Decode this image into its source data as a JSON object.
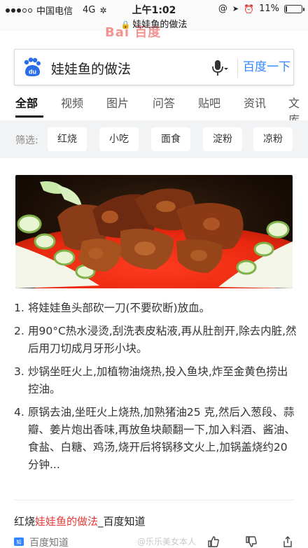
{
  "status_bar": {
    "carrier": "中国电信",
    "network": "4G",
    "time": "上午1:02",
    "battery_text": "11%",
    "battery_level": 0.11
  },
  "url_bar": {
    "page_title": "娃娃鱼的做法",
    "ghost_logo": "Bai 百度"
  },
  "search": {
    "query": "娃娃鱼的做法",
    "button_label": "百度一下",
    "logo_label": "du"
  },
  "tabs": [
    {
      "label": "全部",
      "active": true
    },
    {
      "label": "视频",
      "active": false
    },
    {
      "label": "图片",
      "active": false
    },
    {
      "label": "问答",
      "active": false
    },
    {
      "label": "贴吧",
      "active": false
    },
    {
      "label": "资讯",
      "active": false
    },
    {
      "label": "文库",
      "active": false
    }
  ],
  "filter": {
    "label": "筛选:",
    "chips": [
      "红烧",
      "小吃",
      "面食",
      "淀粉",
      "凉粉"
    ]
  },
  "result": {
    "steps": [
      {
        "num": "1.",
        "text": "将娃娃鱼头部砍一刀(不要砍断)放血。"
      },
      {
        "num": "2.",
        "text": "用90°C热水浸烫,刮洗表皮粘液,再从肚剖开,除去内脏,然后用刀切成月牙形小块。"
      },
      {
        "num": "3.",
        "text": "炒锅坐旺火上,加植物油烧热,投入鱼块,炸至金黄色捞出控油。"
      },
      {
        "num": "4.",
        "text": "原锅去油,坐旺火上烧热,加熟猪油25 克,然后入葱段、蒜瓣、姜片炮出香味,再放鱼块颠翻一下,加入料酒、酱油、食盐、白糖、鸡汤,烧开后将锅移文火上,加锅盖烧约20 分钟..."
      }
    ],
    "title_prefix": "红烧",
    "title_highlight": "娃娃鱼的做法",
    "title_suffix": "_百度知道",
    "source": "百度知道",
    "watermark": "@乐乐美女本人"
  },
  "colors": {
    "accent": "#3385ff",
    "highlight": "#e53935",
    "filter_bg": "#f2f3f5"
  },
  "icons": [
    "signal-icon",
    "wifi-activity-icon",
    "lock-icon",
    "at-icon",
    "location-icon",
    "alarm-icon",
    "battery-icon",
    "paw-logo-icon",
    "microphone-icon",
    "chevron-down-icon",
    "baidu-zhidao-icon",
    "thumbs-up-icon",
    "thumbs-down-icon",
    "share-icon"
  ]
}
